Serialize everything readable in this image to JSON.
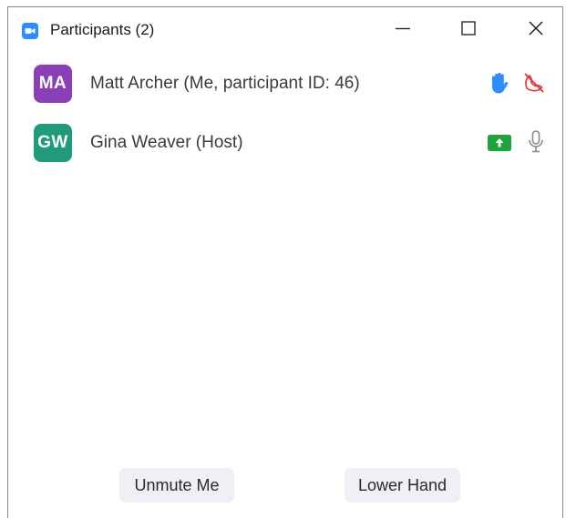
{
  "window": {
    "title": "Participants (2)",
    "icons": {
      "app": "zoom-camera-icon",
      "minimize": "minimize-icon",
      "maximize": "maximize-icon",
      "close": "close-icon"
    }
  },
  "participants": [
    {
      "initials": "MA",
      "name": "Matt Archer (Me, participant ID: 46)",
      "avatar_color": "#8a3fb6",
      "status_icons": [
        "raised-hand-icon",
        "video-off-icon"
      ]
    },
    {
      "initials": "GW",
      "name": "Gina Weaver (Host)",
      "avatar_color": "#1f9a7a",
      "status_icons": [
        "screen-share-icon",
        "microphone-icon"
      ]
    }
  ],
  "actions": {
    "unmute_label": "Unmute Me",
    "lower_hand_label": "Lower Hand"
  },
  "colors": {
    "accent_blue": "#2d8cff",
    "muted_red": "#e8322f",
    "share_green": "#1ea23c",
    "icon_gray": "#8a8a8a",
    "button_bg": "#eef0f6"
  }
}
